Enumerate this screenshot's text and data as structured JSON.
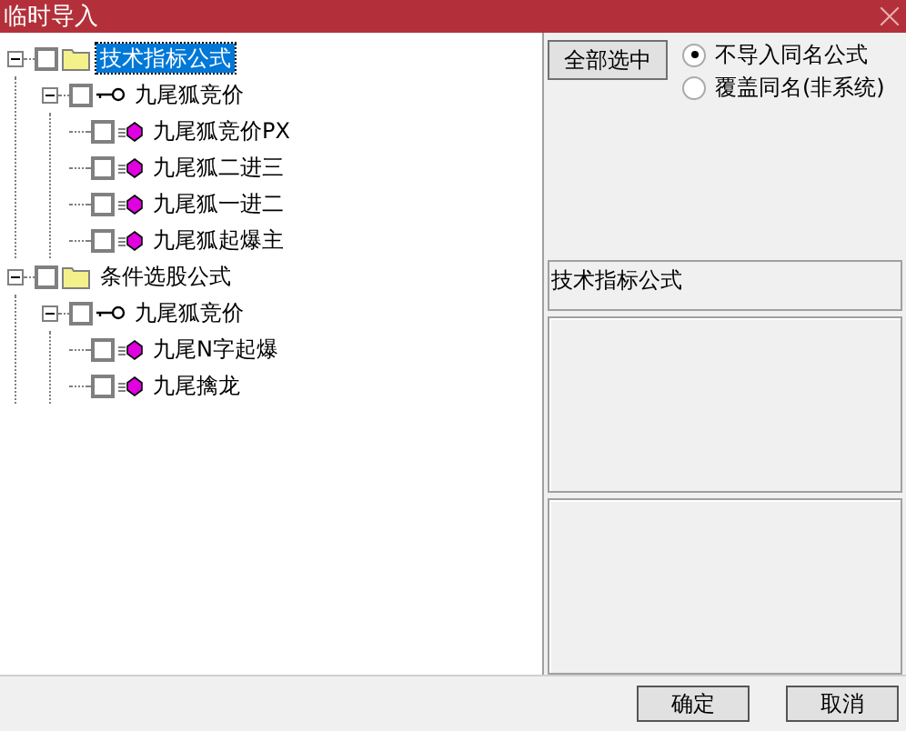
{
  "window": {
    "title": "临时导入"
  },
  "tree": [
    {
      "label": "技术指标公式",
      "kind": "folder",
      "expanded": true,
      "checked": false,
      "selected": true,
      "children": [
        {
          "label": "九尾狐竞价",
          "kind": "key",
          "expanded": true,
          "checked": false,
          "selected": false,
          "children": [
            {
              "label": "九尾狐竞价PX",
              "kind": "formula",
              "checked": false,
              "selected": false
            },
            {
              "label": "九尾狐二进三",
              "kind": "formula",
              "checked": false,
              "selected": false
            },
            {
              "label": "九尾狐一进二",
              "kind": "formula",
              "checked": false,
              "selected": false
            },
            {
              "label": "九尾狐起爆主",
              "kind": "formula",
              "checked": false,
              "selected": false
            }
          ]
        }
      ]
    },
    {
      "label": "条件选股公式",
      "kind": "folder",
      "expanded": true,
      "checked": false,
      "selected": false,
      "children": [
        {
          "label": "九尾狐竞价",
          "kind": "key",
          "expanded": true,
          "checked": false,
          "selected": false,
          "children": [
            {
              "label": "九尾N字起爆",
              "kind": "formula",
              "checked": false,
              "selected": false
            },
            {
              "label": "九尾擒龙",
              "kind": "formula",
              "checked": false,
              "selected": false
            }
          ]
        }
      ]
    }
  ],
  "select_all_button": "全部选中",
  "options": [
    {
      "label": "不导入同名公式",
      "selected": true
    },
    {
      "label": "覆盖同名(非系统)",
      "selected": false
    }
  ],
  "info_panel": {
    "text": "技术指标公式"
  },
  "buttons": [
    "确定",
    "取消"
  ]
}
